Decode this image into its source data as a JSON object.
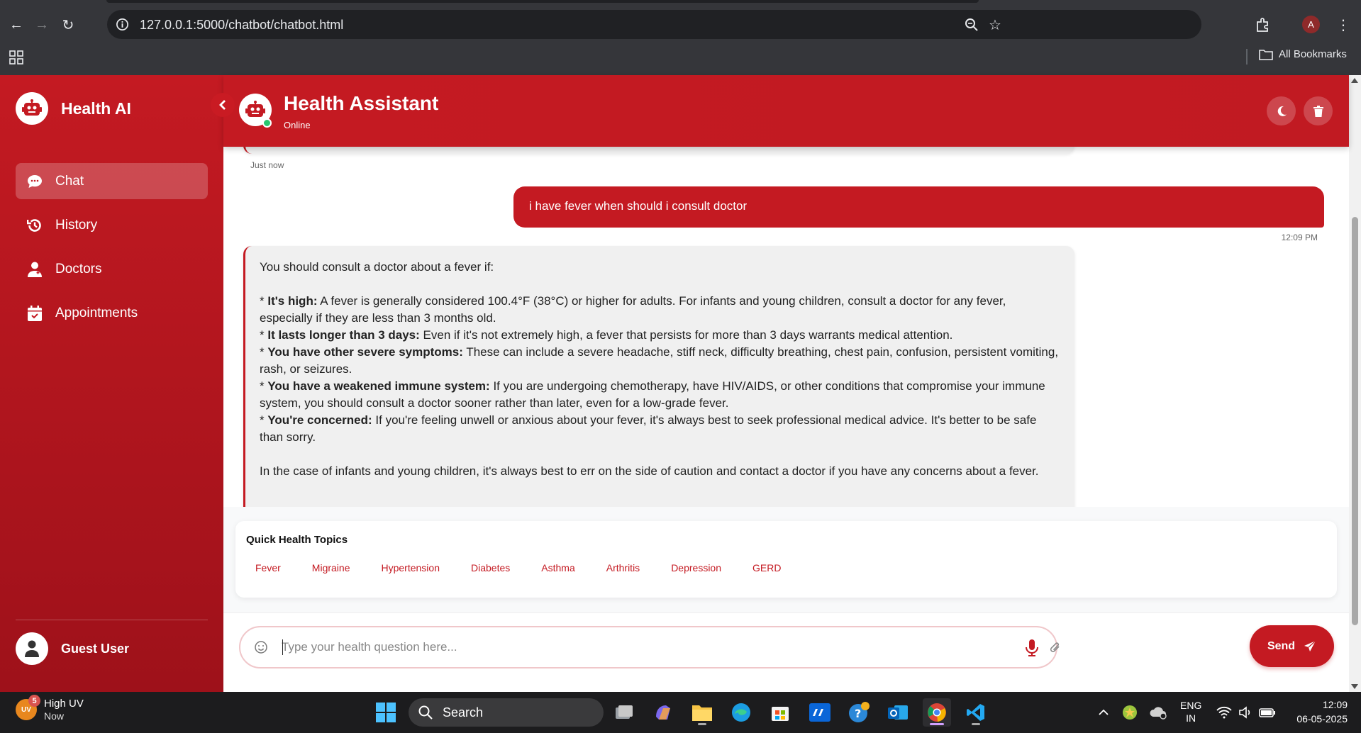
{
  "browser": {
    "url": "127.0.0.1:5000/chatbot/chatbot.html",
    "profile_initial": "A",
    "bookmarks_label": "All Bookmarks"
  },
  "sidebar": {
    "brand": "Health AI",
    "items": [
      {
        "label": "Chat",
        "icon": "chat-icon",
        "active": true
      },
      {
        "label": "History",
        "icon": "history-icon",
        "active": false
      },
      {
        "label": "Doctors",
        "icon": "doctor-icon",
        "active": false
      },
      {
        "label": "Appointments",
        "icon": "calendar-icon",
        "active": false
      }
    ],
    "user_name": "Guest User"
  },
  "header": {
    "title": "Health Assistant",
    "status": "Online"
  },
  "messages": {
    "prev_time": "Just now",
    "user_message": "i have fever when should i consult doctor",
    "user_time": "12:09 PM",
    "bot": {
      "intro": "You should consult a doctor about a fever if:",
      "points": [
        {
          "bold": "It's high:",
          "text": " A fever is generally considered 100.4°F (38°C) or higher for adults. For infants and young children, consult a doctor for any fever, especially if they are less than 3 months old."
        },
        {
          "bold": "It lasts longer than 3 days:",
          "text": " Even if it's not extremely high, a fever that persists for more than 3 days warrants medical attention."
        },
        {
          "bold": "You have other severe symptoms:",
          "text": " These can include a severe headache, stiff neck, difficulty breathing, chest pain, confusion, persistent vomiting, rash, or seizures."
        },
        {
          "bold": "You have a weakened immune system:",
          "text": " If you are undergoing chemotherapy, have HIV/AIDS, or other conditions that compromise your immune system, you should consult a doctor sooner rather than later, even for a low-grade fever."
        },
        {
          "bold": "You're concerned:",
          "text": " If you're feeling unwell or anxious about your fever, it's always best to seek professional medical advice. It's better to be safe than sorry."
        }
      ],
      "outro": "In the case of infants and young children, it's always best to err on the side of caution and contact a doctor if you have any concerns about a fever."
    }
  },
  "topics": {
    "title": "Quick Health Topics",
    "chips": [
      "Fever",
      "Migraine",
      "Hypertension",
      "Diabetes",
      "Asthma",
      "Arthritis",
      "Depression",
      "GERD"
    ]
  },
  "input": {
    "placeholder": "Type your health question here...",
    "value": "",
    "send_label": "Send"
  },
  "taskbar": {
    "weather_title": "High UV",
    "weather_sub": "Now",
    "weather_badge": "5",
    "weather_icon_text": "UV",
    "search_label": "Search",
    "lang_top": "ENG",
    "lang_bottom": "IN",
    "time": "12:09",
    "date": "06-05-2025"
  },
  "colors": {
    "brand_red": "#c41a22",
    "dark_red": "#9e111a",
    "online_green": "#28c76f"
  }
}
